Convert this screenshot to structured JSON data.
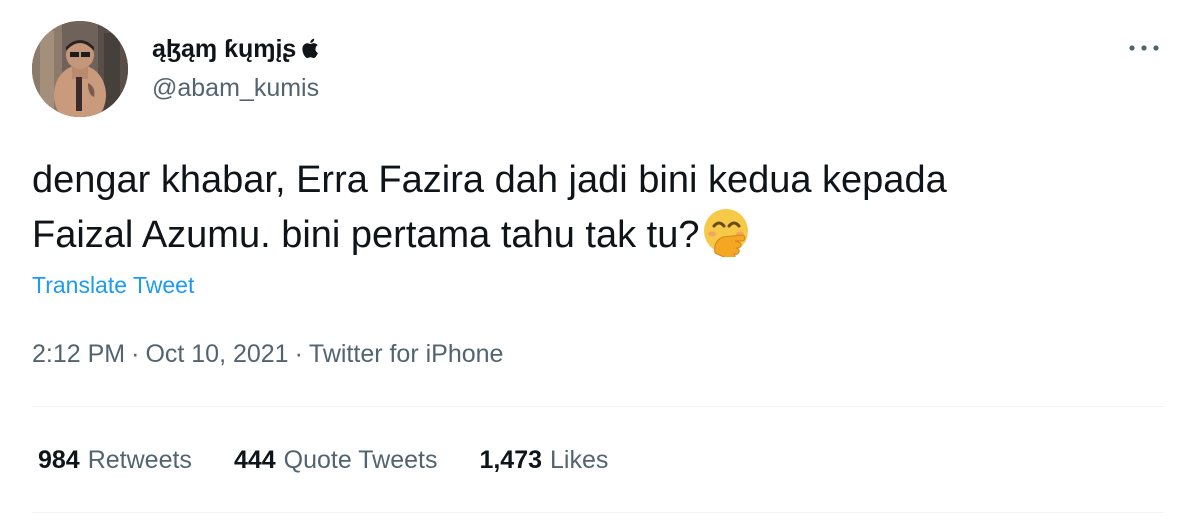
{
  "tweet": {
    "author": {
      "display_name": "ąɮąɱ ƙųɱįʂ",
      "handle": "@abam_kumis",
      "badge_icon": "apple-icon",
      "avatar_icon": "avatar-photo"
    },
    "more_icon": "more-dots-icon",
    "text_lines": [
      "dengar khabar, Erra Fazira dah jadi bini kedua kepada",
      "Faizal Azumu. bini pertama tahu tak tu?"
    ],
    "emoji": "face-with-hand-over-mouth-emoji",
    "translate_label": "Translate Tweet",
    "time": "2:12 PM",
    "separator": "·",
    "date": "Oct 10, 2021",
    "source": "Twitter for iPhone",
    "stats": {
      "retweets": {
        "count": "984",
        "label": "Retweets"
      },
      "quotes": {
        "count": "444",
        "label": "Quote Tweets"
      },
      "likes": {
        "count": "1,473",
        "label": "Likes"
      }
    }
  },
  "colors": {
    "text_primary": "#0f1419",
    "text_secondary": "#536471",
    "link": "#1d9bf0",
    "divider": "#eff3f4",
    "emoji_yellow": "#f7c948"
  }
}
